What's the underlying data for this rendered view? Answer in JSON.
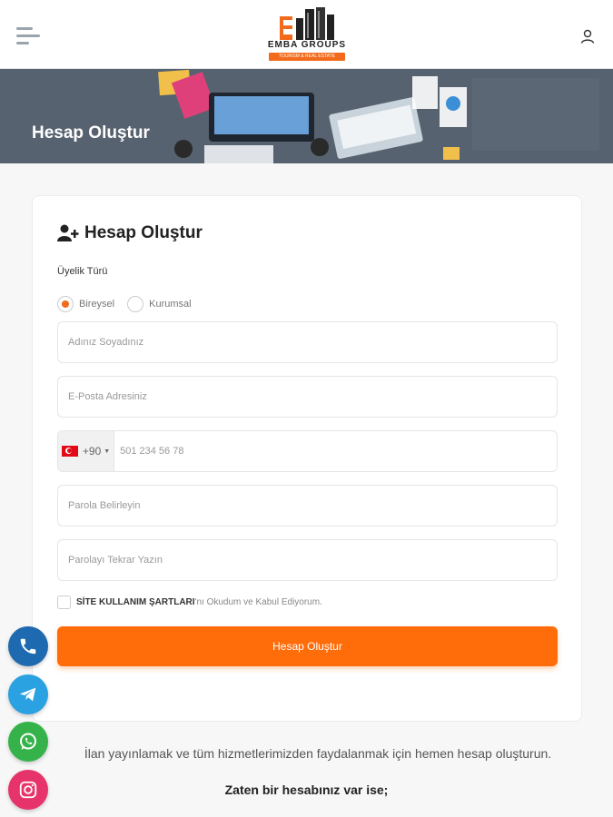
{
  "header": {
    "logo_text": "EMBA GROUPS",
    "logo_subtext": "TOURISM & REAL ESTATE"
  },
  "hero": {
    "title": "Hesap Oluştur"
  },
  "form": {
    "title": "Hesap Oluştur",
    "membership_label": "Üyelik Türü",
    "radio_options": [
      "Bireysel",
      "Kurumsal"
    ],
    "selected_option": "Bireysel",
    "name_placeholder": "Adınız Soyadınız",
    "email_placeholder": "E-Posta Adresiniz",
    "phone_code": "+90",
    "phone_placeholder": "501 234 56 78",
    "password_placeholder": "Parola Belirleyin",
    "password_repeat_placeholder": "Parolayı Tekrar Yazın",
    "terms_strong": "SİTE KULLANIM ŞARTLARI",
    "terms_rest": "'nı Okudum ve Kabul Ediyorum.",
    "submit_label": "Hesap Oluştur"
  },
  "footer": {
    "info": "İlan yayınlamak ve tüm hizmetlerimizden faydalanmak için hemen hesap oluşturun.",
    "login_question": "Zaten bir hesabınız var ise;"
  },
  "colors": {
    "accent": "#ff6c0a",
    "phone": "#1e6ab0",
    "telegram": "#2aa1e1",
    "whatsapp": "#35b34a",
    "instagram": "#e6336b"
  }
}
